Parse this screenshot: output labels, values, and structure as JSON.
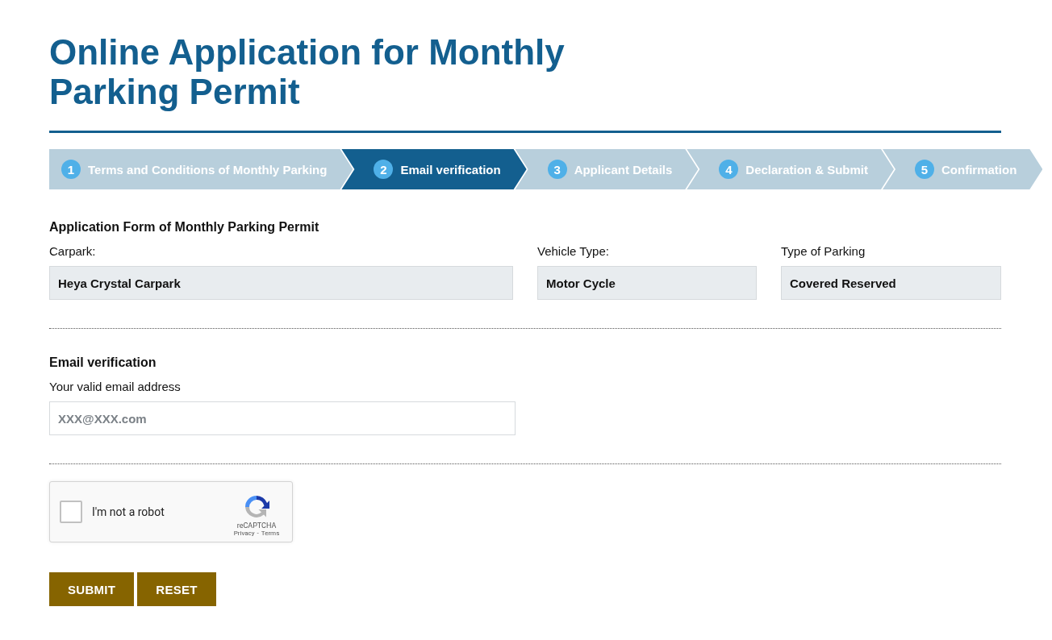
{
  "title": "Online Application for Monthly Parking Permit",
  "steps": [
    {
      "number": "1",
      "label": "Terms and Conditions of Monthly Parking",
      "selected": false
    },
    {
      "number": "2",
      "label": "Email verification",
      "selected": true
    },
    {
      "number": "3",
      "label": "Applicant Details",
      "selected": false
    },
    {
      "number": "4",
      "label": "Declaration & Submit",
      "selected": false
    },
    {
      "number": "5",
      "label": "Confirmation",
      "selected": false
    }
  ],
  "form": {
    "heading": "Application Form of Monthly Parking Permit",
    "fields": [
      {
        "label": "Carpark:",
        "value": "Heya Crystal Carpark"
      },
      {
        "label": "Vehicle Type:",
        "value": "Motor Cycle"
      },
      {
        "label": "Type of Parking",
        "value": "Covered Reserved"
      }
    ]
  },
  "email": {
    "heading": "Email verification",
    "label": "Your valid email address",
    "placeholder": "XXX@XXX.com"
  },
  "captcha": {
    "label": "I'm not a robot",
    "checked": false,
    "brand": "reCAPTCHA",
    "links": [
      "Privacy",
      "Terms"
    ],
    "separator": "-"
  },
  "buttons": [
    "SUBMIT",
    "RESET"
  ]
}
